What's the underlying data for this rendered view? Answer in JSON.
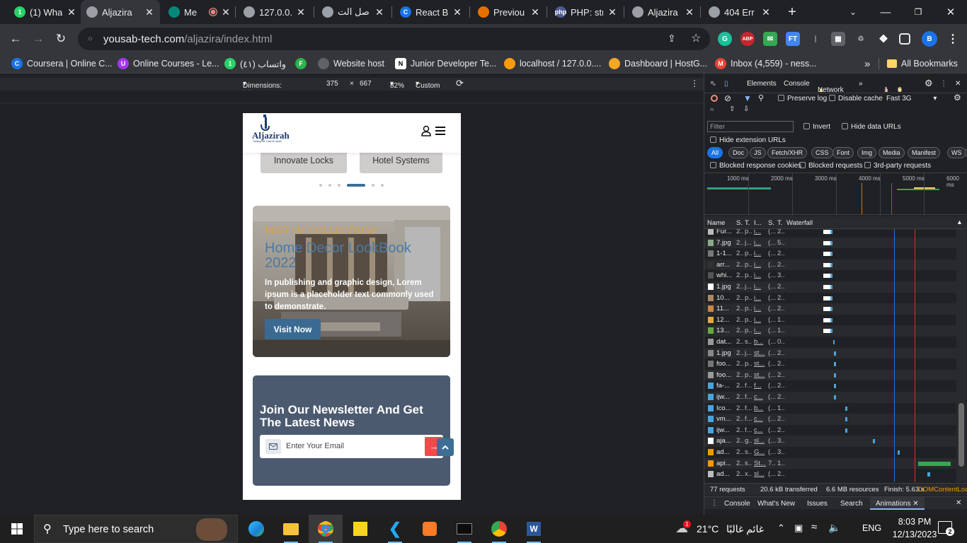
{
  "browser": {
    "tabs": [
      {
        "title": "(1) Wha",
        "favicon": "whatsapp-icon",
        "color": "#25d366",
        "glyph": "1"
      },
      {
        "title": "Aljazira",
        "favicon": "aljazira-icon",
        "color": "#9aa0a6",
        "glyph": "",
        "active": true
      },
      {
        "title": "Me",
        "favicon": "meet-icon",
        "color": "#00897b",
        "glyph": "",
        "recording": true
      },
      {
        "title": "127.0.0.",
        "favicon": "aljazira-icon",
        "color": "#9aa0a6",
        "glyph": ""
      },
      {
        "title": "اصل الت",
        "favicon": "aljazira-icon",
        "color": "#9aa0a6",
        "glyph": ""
      },
      {
        "title": "React B",
        "favicon": "coursera-icon",
        "color": "#1a73e8",
        "glyph": "C"
      },
      {
        "title": "Previou",
        "favicon": "java-icon",
        "color": "#e76f00",
        "glyph": ""
      },
      {
        "title": "PHP: str",
        "favicon": "php-icon",
        "color": "#4f5b93",
        "glyph": "php"
      },
      {
        "title": "Aljazira",
        "favicon": "aljazira-icon",
        "color": "#9aa0a6",
        "glyph": ""
      },
      {
        "title": "404 Err",
        "favicon": "globe-icon",
        "color": "#9aa0a6",
        "glyph": ""
      }
    ],
    "new_tab": "+",
    "url_host": "yousab-tech.com",
    "url_path": "/aljazira/index.html",
    "profile_letter": "B",
    "bookmarks": [
      {
        "label": "Coursera | Online C...",
        "icon": "coursera-icon",
        "color": "#1a73e8",
        "glyph": "C"
      },
      {
        "label": "Online Courses - Le...",
        "icon": "udemy-icon",
        "color": "#a435f0",
        "glyph": "U"
      },
      {
        "label": "واتساب (٤١)",
        "icon": "whatsapp-icon",
        "color": "#25d366",
        "glyph": "1"
      },
      {
        "label": "",
        "icon": "feedly-icon",
        "color": "#2bb24c",
        "glyph": "F"
      },
      {
        "label": "Website host",
        "icon": "globe-icon",
        "color": "#5f6368",
        "glyph": ""
      },
      {
        "label": "Junior Developer Te...",
        "icon": "notion-icon",
        "color": "#ffffff",
        "glyph": "N"
      },
      {
        "label": "localhost / 127.0.0....",
        "icon": "phpmyadmin-icon",
        "color": "#f89c0e",
        "glyph": ""
      },
      {
        "label": "Dashboard | HostG...",
        "icon": "hostgator-icon",
        "color": "#f5a623",
        "glyph": ""
      },
      {
        "label": "Inbox (4,559) - ness...",
        "icon": "gmail-icon",
        "color": "#ea4335",
        "glyph": "M"
      }
    ],
    "more_bookmarks": "»",
    "all_bookmarks": "All Bookmarks"
  },
  "device_toolbar": {
    "dimensions_label": "Dimensions: iPhone SE",
    "width": "375",
    "times": "×",
    "height": "667",
    "zoom": "82%",
    "throttle": "Custom"
  },
  "site": {
    "logo_text": "Aljazirah",
    "logo_tagline": "Trading est. road for years",
    "categories": [
      "Innovate Locks",
      "Hotel Systems"
    ],
    "slider_dots": 6,
    "active_dot": 3,
    "banner": {
      "kicker": "BEST OF COLLECTIONS",
      "title": "Home Decor LookBook 2022",
      "description": "In publishing and graphic design, Lorem ipsum is a placeholder text commonly used to demonstrate.",
      "button": "Visit Now"
    },
    "newsletter": {
      "title": "Join Our Newsletter And Get The Latest News",
      "placeholder": "Enter Your Email"
    }
  },
  "devtools": {
    "tabs": [
      "Elements",
      "Console",
      "Network"
    ],
    "active_tab": "Network",
    "errors": "1",
    "warnings": "6",
    "preserve_log": "Preserve log",
    "disable_cache": "Disable cache",
    "throttle": "Fast 3G",
    "filter_placeholder": "Filter",
    "invert": "Invert",
    "hide_data_urls": "Hide data URLs",
    "hide_extension_urls": "Hide extension URLs",
    "type_filters": [
      "All",
      "Doc",
      "JS",
      "Fetch/XHR",
      "CSS",
      "Font",
      "Img",
      "Media",
      "Manifest",
      "WS",
      "Wasm",
      "Othe"
    ],
    "blocked_cookies": "Blocked response cookies",
    "blocked_requests": "Blocked requests",
    "third_party": "3rd-party requests",
    "timeline_ticks": [
      "1000 ms",
      "2000 ms",
      "3000 ms",
      "4000 ms",
      "5000 ms",
      "6000 ms"
    ],
    "columns": [
      "Name",
      "S.",
      "T.",
      "I...",
      "S.",
      "T.",
      "Waterfall"
    ],
    "requests": [
      {
        "name": "Fur...",
        "s": "2..",
        "t": "p..",
        "i": "i...",
        "sz": "(...",
        "tm": "2..",
        "icon": "#bbb"
      },
      {
        "name": "7.jpg",
        "s": "2..",
        "t": "j...",
        "i": "i...",
        "sz": "(...",
        "tm": "5..",
        "icon": "#8a8"
      },
      {
        "name": "1-1...",
        "s": "2..",
        "t": "p..",
        "i": "i...",
        "sz": "(...",
        "tm": "2..",
        "icon": "#777"
      },
      {
        "name": "arr...",
        "s": "2..",
        "t": "p..",
        "i": "i...",
        "sz": "(...",
        "tm": "2..",
        "icon": "#333"
      },
      {
        "name": "whi...",
        "s": "2..",
        "t": "p..",
        "i": "i...",
        "sz": "(...",
        "tm": "3..",
        "icon": "#555"
      },
      {
        "name": "1.jpg",
        "s": "2..",
        "t": "j...",
        "i": "i...",
        "sz": "(...",
        "tm": "2..",
        "icon": "#fff"
      },
      {
        "name": "10...",
        "s": "2..",
        "t": "p..",
        "i": "i...",
        "sz": "(...",
        "tm": "2..",
        "icon": "#a86"
      },
      {
        "name": "11...",
        "s": "2..",
        "t": "p..",
        "i": "i...",
        "sz": "(...",
        "tm": "2..",
        "icon": "#c84"
      },
      {
        "name": "12...",
        "s": "2..",
        "t": "p..",
        "i": "i...",
        "sz": "(...",
        "tm": "1..",
        "icon": "#da4"
      },
      {
        "name": "13...",
        "s": "2..",
        "t": "p..",
        "i": "i...",
        "sz": "(...",
        "tm": "1..",
        "icon": "#6a4"
      },
      {
        "name": "dat...",
        "s": "2..",
        "t": "s..",
        "i": "b...",
        "sz": "(...",
        "tm": "0..",
        "icon": "#999"
      },
      {
        "name": "1.jpg",
        "s": "2..",
        "t": "j...",
        "i": "st...",
        "sz": "(...",
        "tm": "2..",
        "icon": "#888"
      },
      {
        "name": "foo...",
        "s": "2..",
        "t": "p..",
        "i": "st...",
        "sz": "(...",
        "tm": "2..",
        "icon": "#777"
      },
      {
        "name": "foo...",
        "s": "2..",
        "t": "p..",
        "i": "st...",
        "sz": "(...",
        "tm": "2..",
        "icon": "#999"
      },
      {
        "name": "fa-...",
        "s": "2..",
        "t": "f...",
        "i": "f...",
        "sz": "(...",
        "tm": "2..",
        "icon": "#4aa3df"
      },
      {
        "name": "ijw...",
        "s": "2..",
        "t": "f...",
        "i": "c...",
        "sz": "(...",
        "tm": "2..",
        "icon": "#4aa3df"
      },
      {
        "name": "Ico...",
        "s": "2..",
        "t": "f...",
        "i": "b...",
        "sz": "(...",
        "tm": "1..",
        "icon": "#4aa3df"
      },
      {
        "name": "vm...",
        "s": "2..",
        "t": "f...",
        "i": "c...",
        "sz": "(...",
        "tm": "2..",
        "icon": "#4aa3df"
      },
      {
        "name": "ijw...",
        "s": "2..",
        "t": "f...",
        "i": "c...",
        "sz": "(...",
        "tm": "2..",
        "icon": "#4aa3df"
      },
      {
        "name": "aja...",
        "s": "2..",
        "t": "g..",
        "i": "sl...",
        "sz": "(...",
        "tm": "3..",
        "icon": "#fff"
      },
      {
        "name": "ad...",
        "s": "2..",
        "t": "s..",
        "i": "G...",
        "sz": "(...",
        "tm": "3..",
        "icon": "#f29900"
      },
      {
        "name": "api...",
        "s": "2..",
        "t": "s..",
        "i": "St...",
        "sz": "7..",
        "tm": "1..",
        "icon": "#f29900"
      },
      {
        "name": "ad...",
        "s": "2..",
        "t": "x..",
        "i": "sl...",
        "sz": "(...",
        "tm": "2..",
        "icon": "#bbb"
      }
    ],
    "summary": {
      "requests": "77 requests",
      "transferred": "20.6 kB transferred",
      "resources": "6.6 MB resources",
      "finish": "Finish: 5.63 s",
      "dcl": "DOMContentLoa"
    },
    "drawer_tabs": [
      "Console",
      "What's New",
      "Issues",
      "Search",
      "Animations"
    ]
  },
  "taskbar": {
    "search_placeholder": "Type here to search",
    "weather_temp": "21°C",
    "weather_text": "غائم غالبًا",
    "weather_badge": "1",
    "language": "ENG",
    "time": "8:03 PM",
    "date": "12/13/2023",
    "notification_count": "2"
  }
}
